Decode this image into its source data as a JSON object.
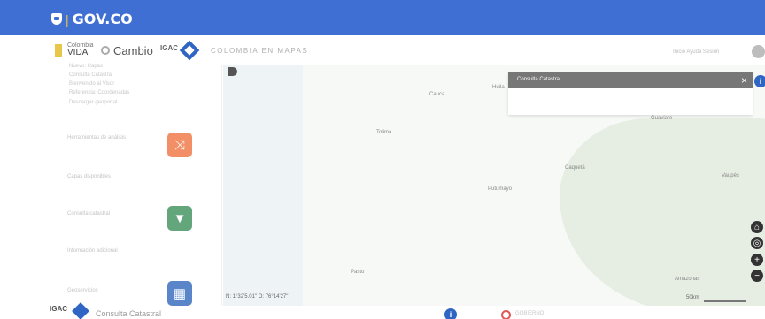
{
  "gov_bar": {
    "label": "GOV.CO"
  },
  "header": {
    "vida_top": "Colombia",
    "vida_label": "VIDA",
    "cambio_label": "Cambio",
    "igac_label": "IGAC",
    "app_title": "COLOMBIA EN MAPAS",
    "header_links": "Inicio   Ayuda   Sesión"
  },
  "sidebar": {
    "info_lines": [
      "Nuevo: Capas",
      "Consulta Catastral",
      "Bienvenido al Visor",
      "Referencia: Coordenadas",
      "Descargar geoportal"
    ],
    "orange_label": "Herramientas de análisis",
    "below_orange": "Capas disponibles",
    "green_label": "Consulta catastral",
    "below_green": "Información adicional",
    "blue_label": "Geoservicios"
  },
  "map": {
    "places": [
      "Cauca",
      "Huila",
      "Tolima",
      "Caquetá",
      "Putumayo",
      "Vaupés",
      "Guaviare",
      "Amazonas",
      "Pasto"
    ],
    "coordinates": "N: 1°32'5.01\" O: 76°14'27\""
  },
  "dialog": {
    "title": "Consulta Catastral",
    "close_symbol": "×"
  },
  "controls": {
    "home": "⌂",
    "locate": "◎",
    "zoom_in": "+",
    "zoom_out": "−",
    "info": "i"
  },
  "scale": {
    "text": "50km"
  },
  "footer": {
    "igac_label": "IGAC",
    "title": "Consulta Catastral",
    "info": "i",
    "gov_text": "GOBIERNO"
  }
}
